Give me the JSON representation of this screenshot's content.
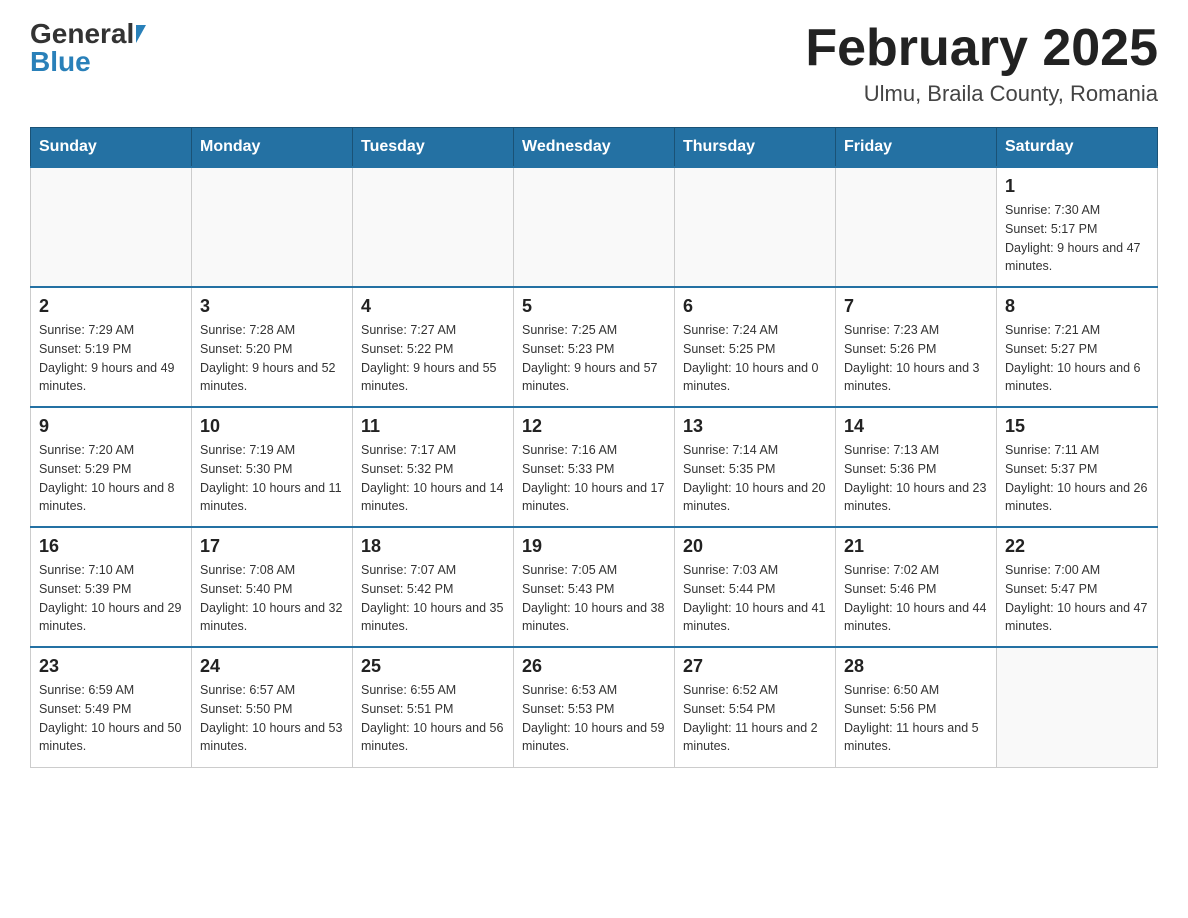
{
  "header": {
    "logo_general": "General",
    "logo_blue": "Blue",
    "title": "February 2025",
    "subtitle": "Ulmu, Braila County, Romania"
  },
  "days_of_week": [
    "Sunday",
    "Monday",
    "Tuesday",
    "Wednesday",
    "Thursday",
    "Friday",
    "Saturday"
  ],
  "weeks": [
    [
      {
        "day": "",
        "info": ""
      },
      {
        "day": "",
        "info": ""
      },
      {
        "day": "",
        "info": ""
      },
      {
        "day": "",
        "info": ""
      },
      {
        "day": "",
        "info": ""
      },
      {
        "day": "",
        "info": ""
      },
      {
        "day": "1",
        "info": "Sunrise: 7:30 AM\nSunset: 5:17 PM\nDaylight: 9 hours and 47 minutes."
      }
    ],
    [
      {
        "day": "2",
        "info": "Sunrise: 7:29 AM\nSunset: 5:19 PM\nDaylight: 9 hours and 49 minutes."
      },
      {
        "day": "3",
        "info": "Sunrise: 7:28 AM\nSunset: 5:20 PM\nDaylight: 9 hours and 52 minutes."
      },
      {
        "day": "4",
        "info": "Sunrise: 7:27 AM\nSunset: 5:22 PM\nDaylight: 9 hours and 55 minutes."
      },
      {
        "day": "5",
        "info": "Sunrise: 7:25 AM\nSunset: 5:23 PM\nDaylight: 9 hours and 57 minutes."
      },
      {
        "day": "6",
        "info": "Sunrise: 7:24 AM\nSunset: 5:25 PM\nDaylight: 10 hours and 0 minutes."
      },
      {
        "day": "7",
        "info": "Sunrise: 7:23 AM\nSunset: 5:26 PM\nDaylight: 10 hours and 3 minutes."
      },
      {
        "day": "8",
        "info": "Sunrise: 7:21 AM\nSunset: 5:27 PM\nDaylight: 10 hours and 6 minutes."
      }
    ],
    [
      {
        "day": "9",
        "info": "Sunrise: 7:20 AM\nSunset: 5:29 PM\nDaylight: 10 hours and 8 minutes."
      },
      {
        "day": "10",
        "info": "Sunrise: 7:19 AM\nSunset: 5:30 PM\nDaylight: 10 hours and 11 minutes."
      },
      {
        "day": "11",
        "info": "Sunrise: 7:17 AM\nSunset: 5:32 PM\nDaylight: 10 hours and 14 minutes."
      },
      {
        "day": "12",
        "info": "Sunrise: 7:16 AM\nSunset: 5:33 PM\nDaylight: 10 hours and 17 minutes."
      },
      {
        "day": "13",
        "info": "Sunrise: 7:14 AM\nSunset: 5:35 PM\nDaylight: 10 hours and 20 minutes."
      },
      {
        "day": "14",
        "info": "Sunrise: 7:13 AM\nSunset: 5:36 PM\nDaylight: 10 hours and 23 minutes."
      },
      {
        "day": "15",
        "info": "Sunrise: 7:11 AM\nSunset: 5:37 PM\nDaylight: 10 hours and 26 minutes."
      }
    ],
    [
      {
        "day": "16",
        "info": "Sunrise: 7:10 AM\nSunset: 5:39 PM\nDaylight: 10 hours and 29 minutes."
      },
      {
        "day": "17",
        "info": "Sunrise: 7:08 AM\nSunset: 5:40 PM\nDaylight: 10 hours and 32 minutes."
      },
      {
        "day": "18",
        "info": "Sunrise: 7:07 AM\nSunset: 5:42 PM\nDaylight: 10 hours and 35 minutes."
      },
      {
        "day": "19",
        "info": "Sunrise: 7:05 AM\nSunset: 5:43 PM\nDaylight: 10 hours and 38 minutes."
      },
      {
        "day": "20",
        "info": "Sunrise: 7:03 AM\nSunset: 5:44 PM\nDaylight: 10 hours and 41 minutes."
      },
      {
        "day": "21",
        "info": "Sunrise: 7:02 AM\nSunset: 5:46 PM\nDaylight: 10 hours and 44 minutes."
      },
      {
        "day": "22",
        "info": "Sunrise: 7:00 AM\nSunset: 5:47 PM\nDaylight: 10 hours and 47 minutes."
      }
    ],
    [
      {
        "day": "23",
        "info": "Sunrise: 6:59 AM\nSunset: 5:49 PM\nDaylight: 10 hours and 50 minutes."
      },
      {
        "day": "24",
        "info": "Sunrise: 6:57 AM\nSunset: 5:50 PM\nDaylight: 10 hours and 53 minutes."
      },
      {
        "day": "25",
        "info": "Sunrise: 6:55 AM\nSunset: 5:51 PM\nDaylight: 10 hours and 56 minutes."
      },
      {
        "day": "26",
        "info": "Sunrise: 6:53 AM\nSunset: 5:53 PM\nDaylight: 10 hours and 59 minutes."
      },
      {
        "day": "27",
        "info": "Sunrise: 6:52 AM\nSunset: 5:54 PM\nDaylight: 11 hours and 2 minutes."
      },
      {
        "day": "28",
        "info": "Sunrise: 6:50 AM\nSunset: 5:56 PM\nDaylight: 11 hours and 5 minutes."
      },
      {
        "day": "",
        "info": ""
      }
    ]
  ]
}
